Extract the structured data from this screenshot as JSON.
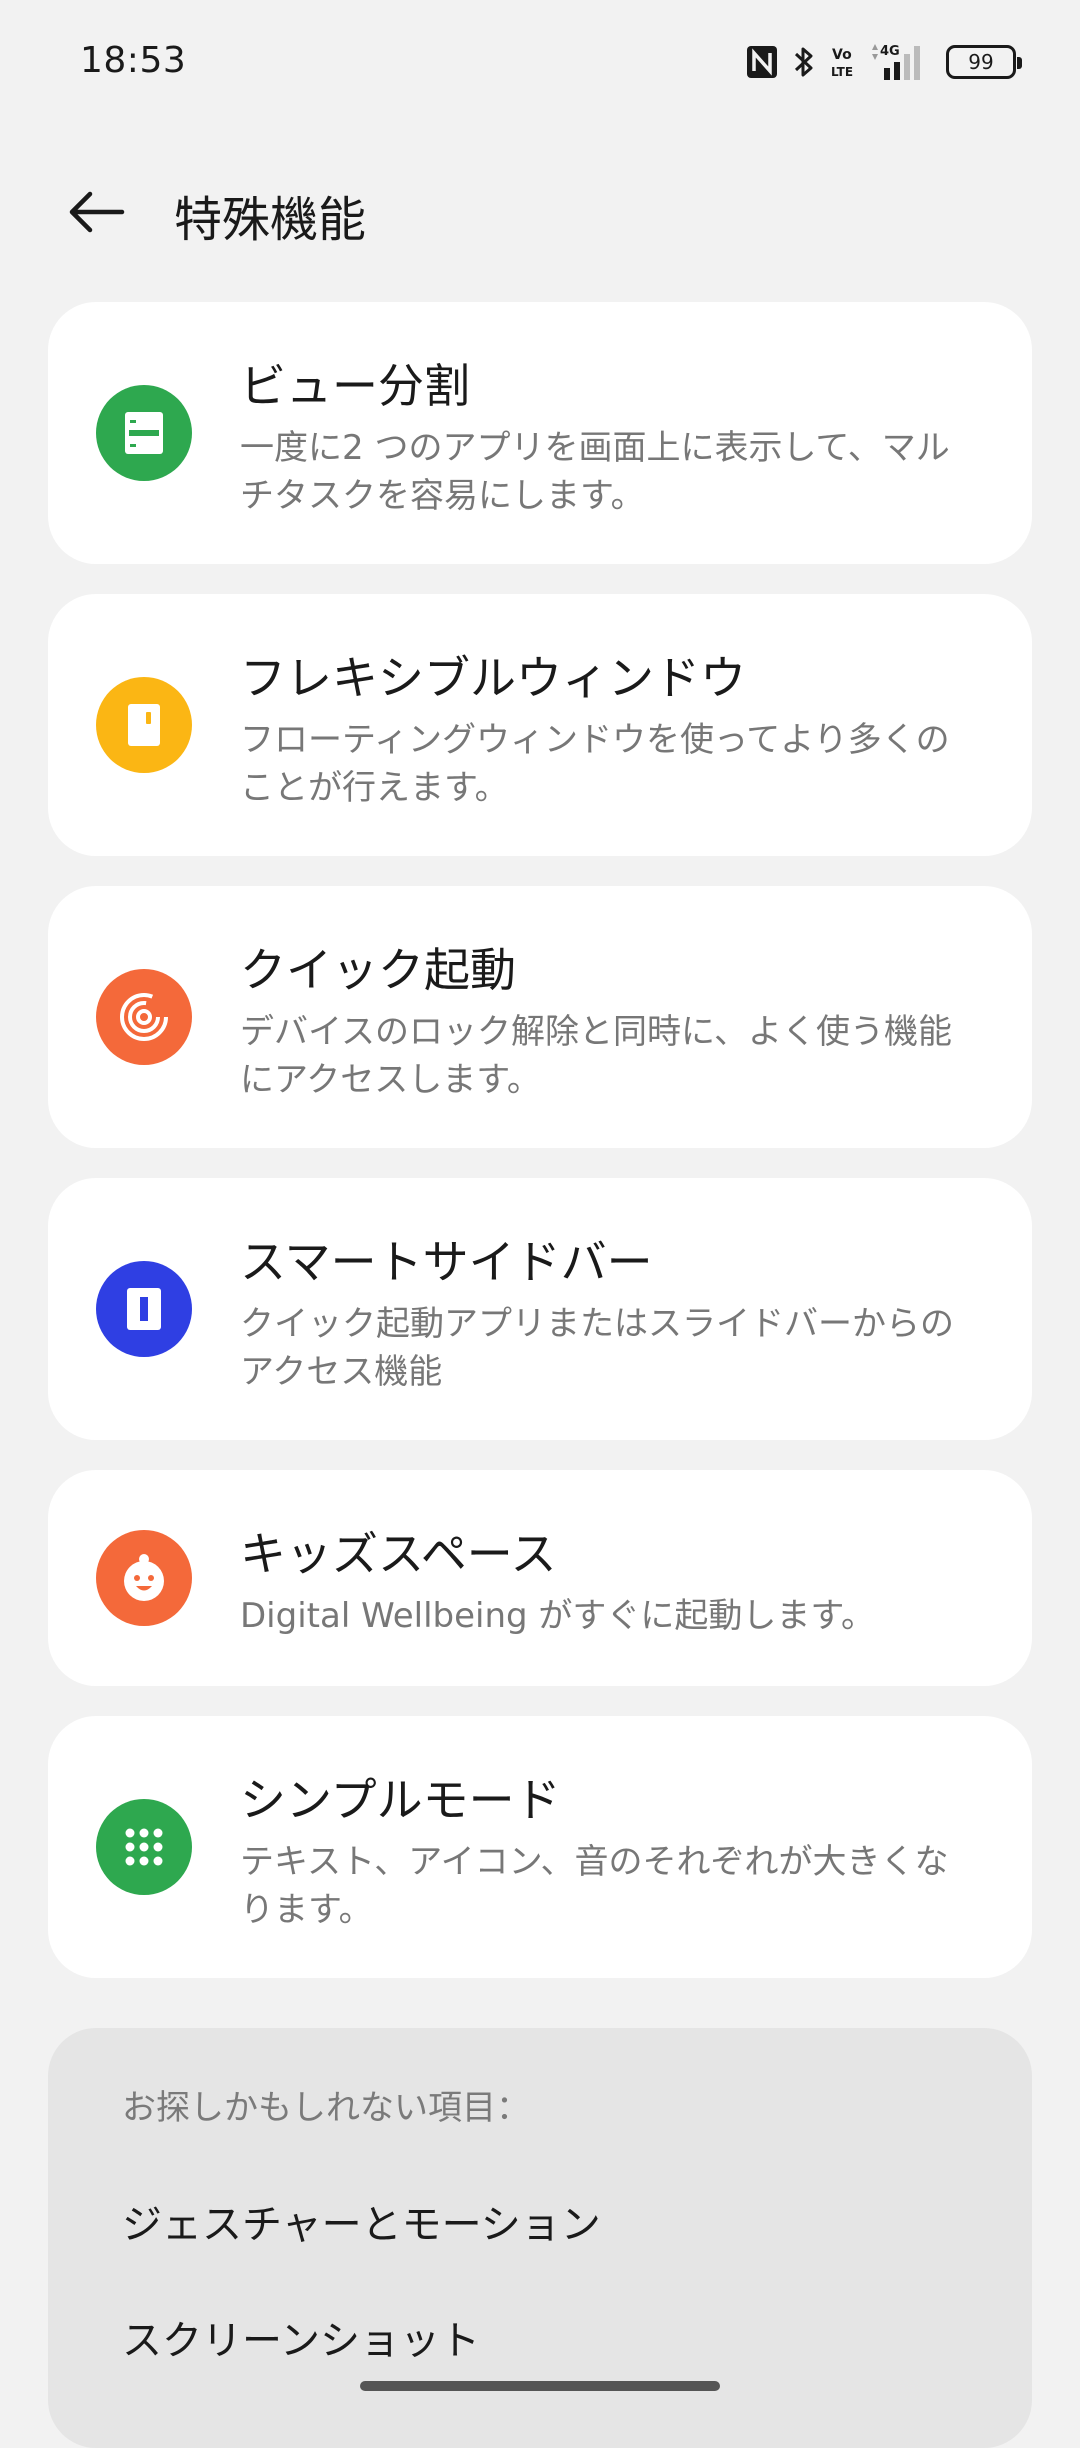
{
  "status_bar": {
    "time": "18:53",
    "signal_label": "4G",
    "volte_label": "Vo LTE",
    "battery": "99"
  },
  "header": {
    "title": "特殊機能"
  },
  "features": [
    {
      "title": "ビュー分割",
      "description": "一度に2 つのアプリを画面上に表示して、マルチタスクを容易にします。",
      "icon": "split-view-icon",
      "color": "#2ea84f"
    },
    {
      "title": "フレキシブルウィンドウ",
      "description": "フローティングウィンドウを使ってより多くのことが行えます。",
      "icon": "flexible-window-icon",
      "color": "#fbb614"
    },
    {
      "title": "クイック起動",
      "description": "デバイスのロック解除と同時に、よく使う機能にアクセスします。",
      "icon": "fingerprint-icon",
      "color": "#f4693a"
    },
    {
      "title": "スマートサイドバー",
      "description": "クイック起動アプリまたはスライドバーからのアクセス機能",
      "icon": "sidebar-icon",
      "color": "#2f3fe3"
    },
    {
      "title": "キッズスペース",
      "description": "Digital Wellbeing がすぐに起動します。",
      "icon": "kid-face-icon",
      "color": "#f4693a"
    },
    {
      "title": "シンプルモード",
      "description": "テキスト、アイコン、音のそれぞれが大きくなります。",
      "icon": "grid-dots-icon",
      "color": "#2ea84f"
    }
  ],
  "suggestions": {
    "heading": "お探しかもしれない項目：",
    "items": [
      "ジェスチャーとモーション",
      "スクリーンショット"
    ]
  }
}
